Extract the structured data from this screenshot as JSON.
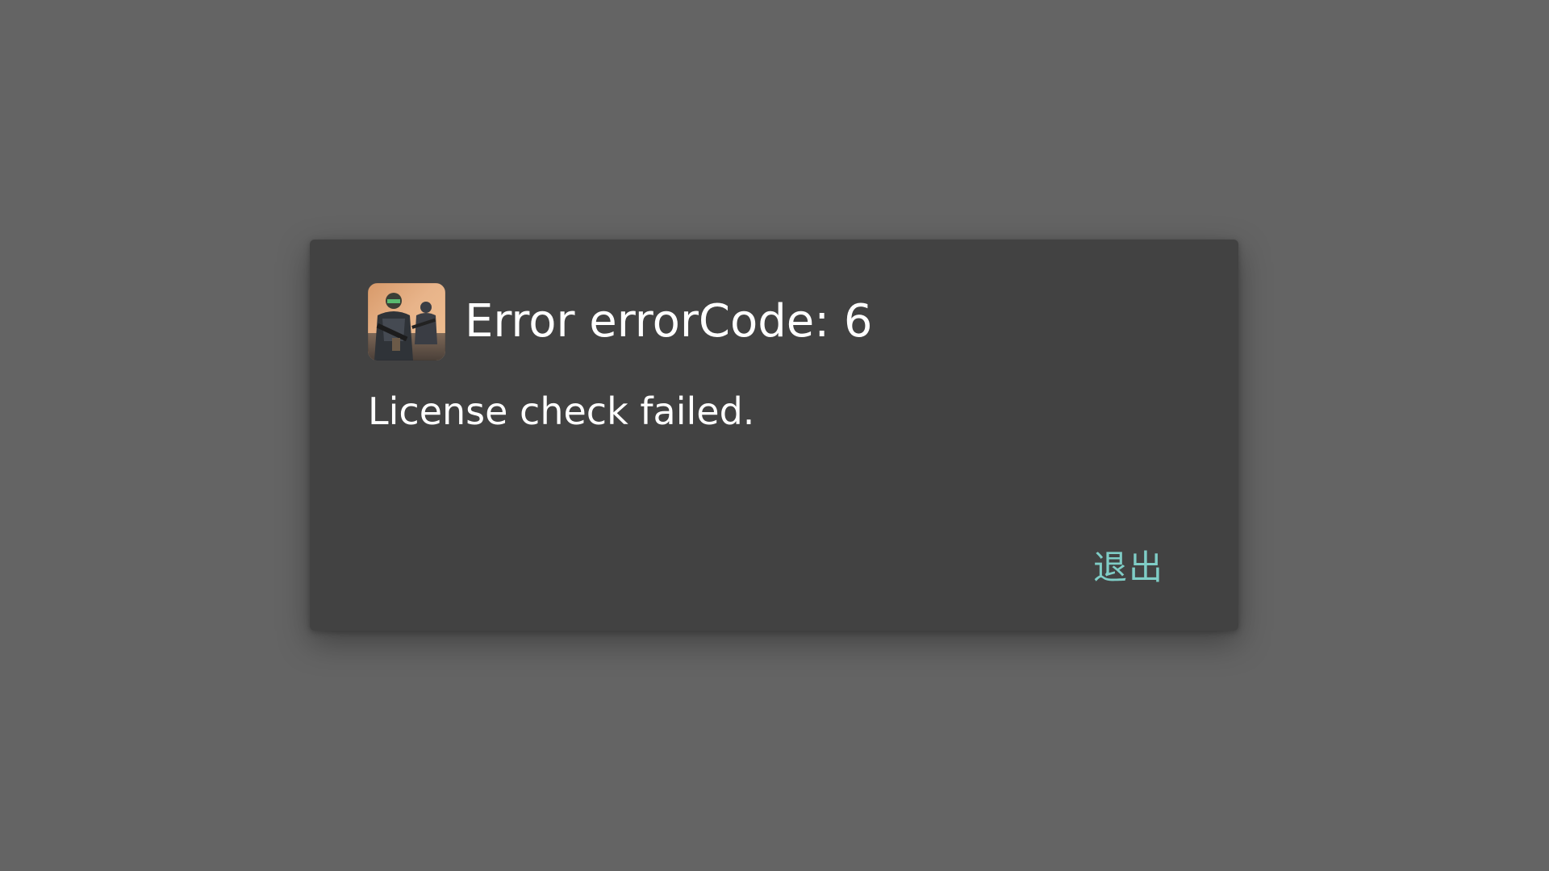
{
  "dialog": {
    "app_icon": "soldiers-game-icon",
    "title": "Error errorCode: 6",
    "message": "License check failed.",
    "exit_label": "退出"
  },
  "colors": {
    "backdrop": "#646464",
    "dialog_background": "#424242",
    "text": "#ffffff",
    "accent": "#7fcdc6"
  }
}
